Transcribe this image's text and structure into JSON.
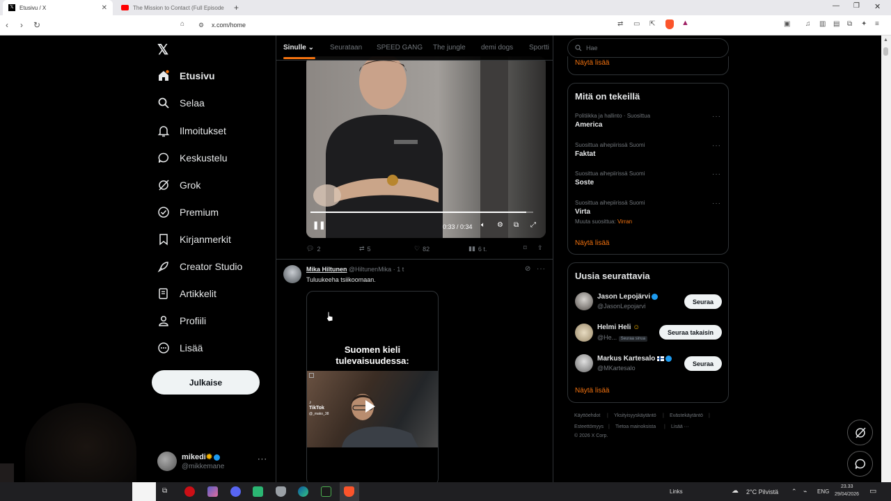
{
  "browser": {
    "tabs": [
      {
        "title": "Etusivu / X",
        "active": true
      },
      {
        "title": "The Mission to Contact (Full Episode",
        "active": false
      }
    ],
    "url": "x.com/home"
  },
  "nav": {
    "items": [
      {
        "label": "Etusivu",
        "icon": "home-icon"
      },
      {
        "label": "Selaa",
        "icon": "search-icon"
      },
      {
        "label": "Ilmoitukset",
        "icon": "bell-icon"
      },
      {
        "label": "Keskustelu",
        "icon": "chat-icon"
      },
      {
        "label": "Grok",
        "icon": "grok-icon"
      },
      {
        "label": "Premium",
        "icon": "premium-icon"
      },
      {
        "label": "Kirjanmerkit",
        "icon": "bookmark-icon"
      },
      {
        "label": "Creator Studio",
        "icon": "rocket-icon"
      },
      {
        "label": "Artikkelit",
        "icon": "article-icon"
      },
      {
        "label": "Profiili",
        "icon": "person-icon"
      },
      {
        "label": "Lisää",
        "icon": "more-circle-icon"
      }
    ],
    "post_button": "Julkaise",
    "account": {
      "name": "mikedi",
      "handle": "@mikkemane"
    }
  },
  "feed": {
    "tabs": [
      "Sinulle",
      "Seurataan",
      "SPEED GANG",
      "The jungle",
      "demi dogs",
      "Sportti"
    ],
    "video": {
      "time": "0:33 / 0:34",
      "progress": 0.97
    },
    "post1_actions": {
      "replies": "2",
      "reposts": "5",
      "likes": "82",
      "views": "6 t."
    },
    "post2": {
      "name": "Mika Hiltunen",
      "handle": "@HiltunenMika",
      "time": "· 1 t",
      "text": "Tuluukeeha tsiikoomaan.",
      "media_caption_line1": "Suomen kieli",
      "media_caption_line2": "tulevaisuudessa:",
      "tiktok_label": "TikTok",
      "tiktok_user": "@_mako_38"
    }
  },
  "sidebar": {
    "search_placeholder": "Hae",
    "top_showmore": "Näytä lisää",
    "trends_title": "Mitä on tekeillä",
    "trends": [
      {
        "meta": "Politiikka ja hallinto · Suosittua",
        "name": "America",
        "extra": ""
      },
      {
        "meta": "Suosittua aihepiirissä Suomi",
        "name": "Faktat",
        "extra": ""
      },
      {
        "meta": "Suosittua aihepiirissä Suomi",
        "name": "Soste",
        "extra": ""
      },
      {
        "meta": "Suosittua aihepiirissä Suomi",
        "name": "Virta",
        "extra_prefix": "Muuta suosittua:",
        "extra": "Virran"
      }
    ],
    "trends_showmore": "Näytä lisää",
    "follow_title": "Uusia seurattavia",
    "follows": [
      {
        "name": "Jason Lepojärvi",
        "handle": "@JasonLepojarvi",
        "button": "Seuraa",
        "badge": ""
      },
      {
        "name": "Helmi Heli",
        "handle": "@He...",
        "button": "Seuraa takaisin",
        "badge": "Seuraa sinua"
      },
      {
        "name": "Markus Kartesalo",
        "handle": "@MKartesalo",
        "button": "Seuraa",
        "badge": ""
      }
    ],
    "follow_showmore": "Näytä lisää",
    "footer": [
      "Käyttöehdot",
      "Yksityisyyskäytäntö",
      "Evästekäytäntö",
      "Esteettömyys",
      "Tietoa mainoksista",
      "Lisää ···",
      "© 2026 X Corp."
    ]
  },
  "taskbar": {
    "links": "Links",
    "weather": "2°C  Pilvistä",
    "lang": "ENG",
    "time": "23.33",
    "date": "29/04/2026"
  }
}
